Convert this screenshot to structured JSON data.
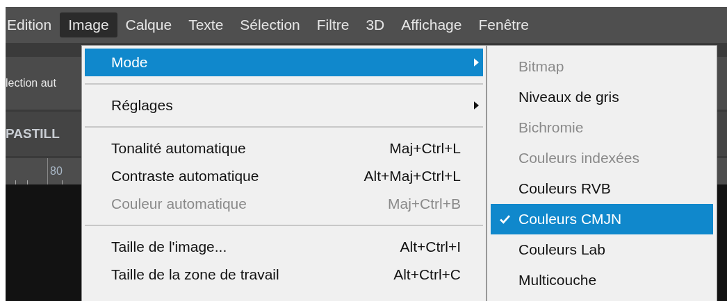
{
  "menubar": [
    {
      "label": "Edition",
      "selected": false
    },
    {
      "label": "Image",
      "selected": true
    },
    {
      "label": "Calque",
      "selected": false
    },
    {
      "label": "Texte",
      "selected": false
    },
    {
      "label": "Sélection",
      "selected": false
    },
    {
      "label": "Filtre",
      "selected": false
    },
    {
      "label": "3D",
      "selected": false
    },
    {
      "label": "Affichage",
      "selected": false
    },
    {
      "label": "Fenêtre",
      "selected": false
    }
  ],
  "options_bar": {
    "text": "lection aut"
  },
  "panel": {
    "title": "PASTILL"
  },
  "ruler": {
    "label": "80"
  },
  "image_menu": {
    "items": [
      {
        "kind": "item",
        "label": "Mode",
        "submenu": true,
        "disabled": false,
        "selected": true
      },
      {
        "kind": "separator"
      },
      {
        "kind": "item",
        "label": "Réglages",
        "submenu": true,
        "disabled": false,
        "selected": false
      },
      {
        "kind": "separator"
      },
      {
        "kind": "item",
        "label": "Tonalité automatique",
        "shortcut": "Maj+Ctrl+L",
        "submenu": false,
        "disabled": false,
        "selected": false
      },
      {
        "kind": "item",
        "label": "Contraste automatique",
        "shortcut": "Alt+Maj+Ctrl+L",
        "submenu": false,
        "disabled": false,
        "selected": false
      },
      {
        "kind": "item",
        "label": "Couleur automatique",
        "shortcut": "Maj+Ctrl+B",
        "submenu": false,
        "disabled": true,
        "selected": false
      },
      {
        "kind": "separator"
      },
      {
        "kind": "item",
        "label": "Taille de l'image...",
        "shortcut": "Alt+Ctrl+I",
        "submenu": false,
        "disabled": false,
        "selected": false
      },
      {
        "kind": "item",
        "label": "Taille de la zone de travail",
        "shortcut": "Alt+Ctrl+C",
        "submenu": false,
        "disabled": false,
        "selected": false
      }
    ]
  },
  "mode_submenu": {
    "items": [
      {
        "label": "Bitmap",
        "disabled": true,
        "checked": false,
        "selected": false
      },
      {
        "label": "Niveaux de gris",
        "disabled": false,
        "checked": false,
        "selected": false
      },
      {
        "label": "Bichromie",
        "disabled": true,
        "checked": false,
        "selected": false
      },
      {
        "label": "Couleurs indexées",
        "disabled": true,
        "checked": false,
        "selected": false
      },
      {
        "label": "Couleurs RVB",
        "disabled": false,
        "checked": false,
        "selected": false
      },
      {
        "label": "Couleurs CMJN",
        "disabled": false,
        "checked": true,
        "selected": true
      },
      {
        "label": "Couleurs Lab",
        "disabled": false,
        "checked": false,
        "selected": false
      },
      {
        "label": "Multicouche",
        "disabled": false,
        "checked": false,
        "selected": false
      }
    ]
  }
}
